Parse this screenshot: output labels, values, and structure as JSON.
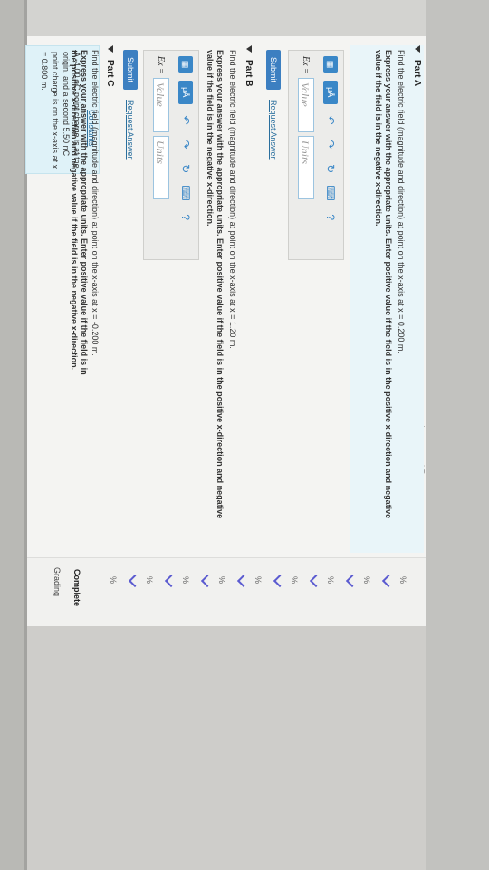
{
  "constants": {
    "link": "Constants",
    "problem": "A -4.00 nC point charge is at the origin, and a second 5.50 nC point charge is on the x-axis at x = 0.800 m."
  },
  "side_tabs": [
    "sh",
    "d R",
    "ma",
    "rai",
    "he",
    "re"
  ],
  "partA": {
    "title": "Part A",
    "question": "Find the electric field (magnitude and direction) at point on the x-axis at x = 0.200 m.",
    "instructions": "Express your answer with the appropriate units. Enter positive value if the field is in the positive x-direction and negative value if the field is in the negative x-direction.",
    "label": "Ex =",
    "value_placeholder": "Value",
    "units_placeholder": "Units",
    "submit": "Submit",
    "request": "Request Answer"
  },
  "partB": {
    "title": "Part B",
    "question": "Find the electric field (magnitude and direction) at point on the x-axis at x = 1.20 m.",
    "instructions": "Express your answer with the appropriate units. Enter positive value if the field is in the positive x-direction and negative value if the field is in the negative x-direction.",
    "label": "Ex =",
    "value_placeholder": "Value",
    "units_placeholder": "Units",
    "submit": "Submit",
    "request": "Request Answer"
  },
  "partC": {
    "title": "Part C",
    "question": "Find the electric field (magnitude and direction) at point on the x-axis at x = -0.200 m.",
    "instructions": "Express your answer with the appropriate units. Enter positive value if the field is in the positive x-direction and negative value if the field is in the negative x-direction."
  },
  "toolbar": {
    "templates": "▦",
    "mu": "μÅ",
    "undo": "↶",
    "redo": "↷",
    "reset": "↻",
    "keyboard": "⌨",
    "help": "?"
  },
  "grading": {
    "title": "Grading",
    "complete": "Complete",
    "rows": [
      "%",
      "%",
      "%",
      "%",
      "%",
      "%",
      "%",
      "%",
      "%"
    ]
  },
  "colors": {
    "accent": "#3a87c7",
    "panel": "#dff2f8",
    "check": "#5b5bd0"
  }
}
